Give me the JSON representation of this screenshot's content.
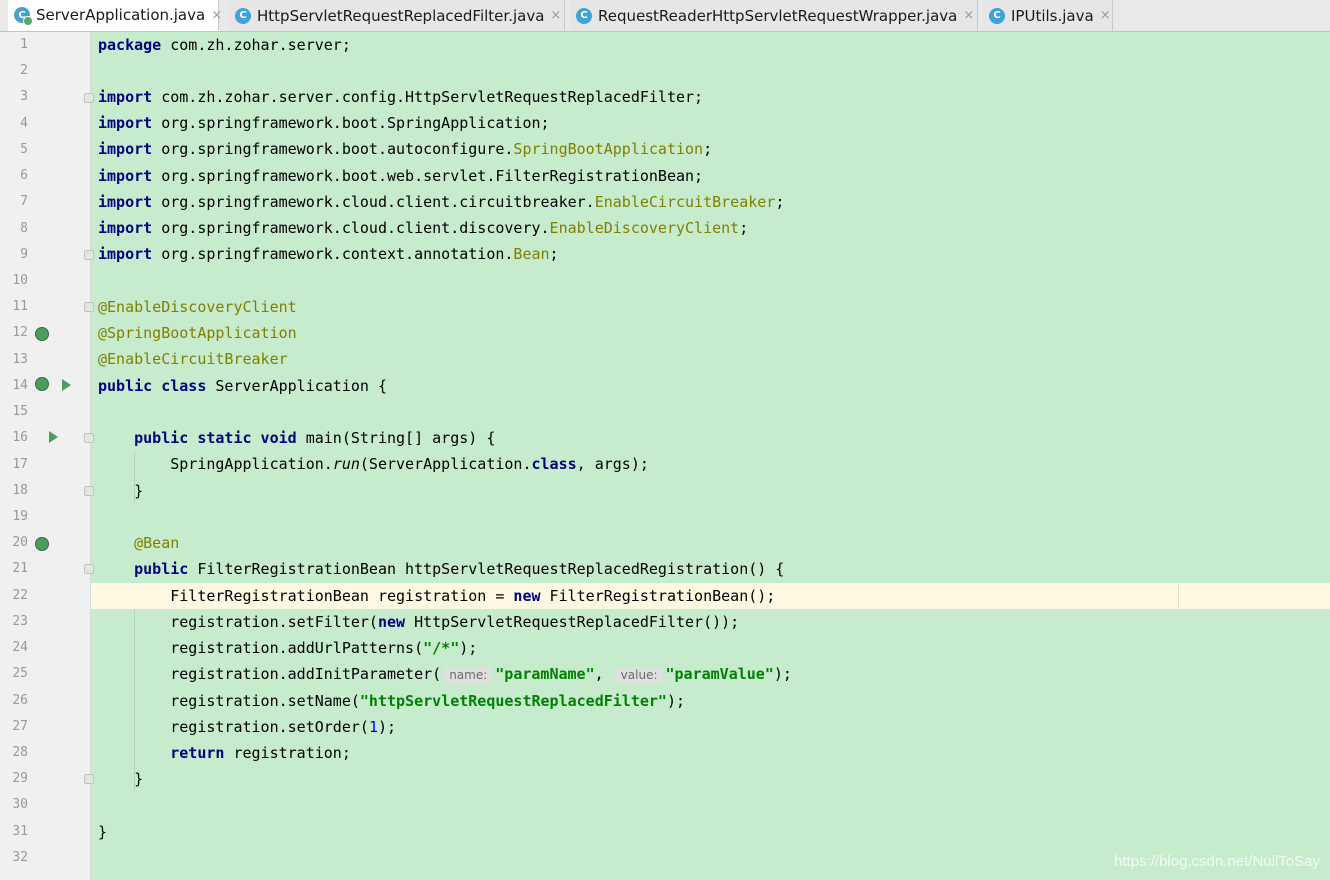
{
  "tabs": [
    {
      "label": "ServerApplication.java",
      "icon": "spring-class-icon",
      "active": true
    },
    {
      "label": "HttpServletRequestReplacedFilter.java",
      "icon": "class-icon",
      "active": false
    },
    {
      "label": "RequestReaderHttpServletRequestWrapper.java",
      "icon": "class-icon",
      "active": false
    },
    {
      "label": "IPUtils.java",
      "icon": "class-icon",
      "active": false
    }
  ],
  "close_glyph": "×",
  "class_glyph": "C",
  "line_numbers": [
    "1",
    "2",
    "3",
    "4",
    "5",
    "6",
    "7",
    "8",
    "9",
    "10",
    "11",
    "12",
    "13",
    "14",
    "15",
    "16",
    "17",
    "18",
    "19",
    "20",
    "21",
    "22",
    "23",
    "24",
    "25",
    "26",
    "27",
    "28",
    "29",
    "30",
    "31",
    "32"
  ],
  "current_line": 22,
  "code": {
    "l1_kw": "package",
    "l1_rest": " com.zh.zohar.server;",
    "import_kw": "import",
    "l3_rest": " com.zh.zohar.server.config.HttpServletRequestReplacedFilter;",
    "l4_rest": " org.springframework.boot.SpringApplication;",
    "l5_pre": " org.springframework.boot.autoconfigure.",
    "l5_ann": "SpringBootApplication",
    "semi": ";",
    "l6_rest": " org.springframework.boot.web.servlet.FilterRegistrationBean;",
    "l7_pre": " org.springframework.cloud.client.circuitbreaker.",
    "l7_ann": "EnableCircuitBreaker",
    "l8_pre": " org.springframework.cloud.client.discovery.",
    "l8_ann": "EnableDiscoveryClient",
    "l9_pre": " org.springframework.context.annotation.",
    "l9_ann": "Bean",
    "l11": "@EnableDiscoveryClient",
    "l12": "@SpringBootApplication",
    "l13": "@EnableCircuitBreaker",
    "l14_kw": "public class",
    "l14_rest": " ServerApplication {",
    "l16_kw": "public static void",
    "l16_rest": " main(String[] args) {",
    "l17_pre": "SpringApplication.",
    "l17_it": "run",
    "l17_mid": "(ServerApplication.",
    "l17_kw": "class",
    "l17_end": ", args);",
    "close_brace": "}",
    "l20": "@Bean",
    "l21_kw": "public",
    "l21_rest": " FilterRegistrationBean httpServletRequestReplacedRegistration() {",
    "l22_pre": "FilterRegistrationBean registration = ",
    "new_kw": "new",
    "l22_end": " FilterRegistrationBean();",
    "l23_pre": "registration.setFilter(",
    "l23_end": " HttpServletRequestReplacedFilter());",
    "l24_pre": "registration.addUrlPatterns(",
    "l24_str": "\"/*\"",
    "l24_end": ");",
    "l25_pre": "registration.addInitParameter(",
    "l25_hint1": "name:",
    "l25_str1": "\"paramName\"",
    "comma": ", ",
    "l25_hint2": "value:",
    "l25_str2": "\"paramValue\"",
    "l25_end": ");",
    "l26_pre": "registration.setName(",
    "l26_str": "\"httpServletRequestReplacedFilter\"",
    "l26_end": ");",
    "l27_pre": "registration.setOrder(",
    "l27_num": "1",
    "l27_end": ");",
    "l28_kw": "return",
    "l28_rest": " registration;"
  },
  "watermark": "https://blog.csdn.net/NullToSay"
}
